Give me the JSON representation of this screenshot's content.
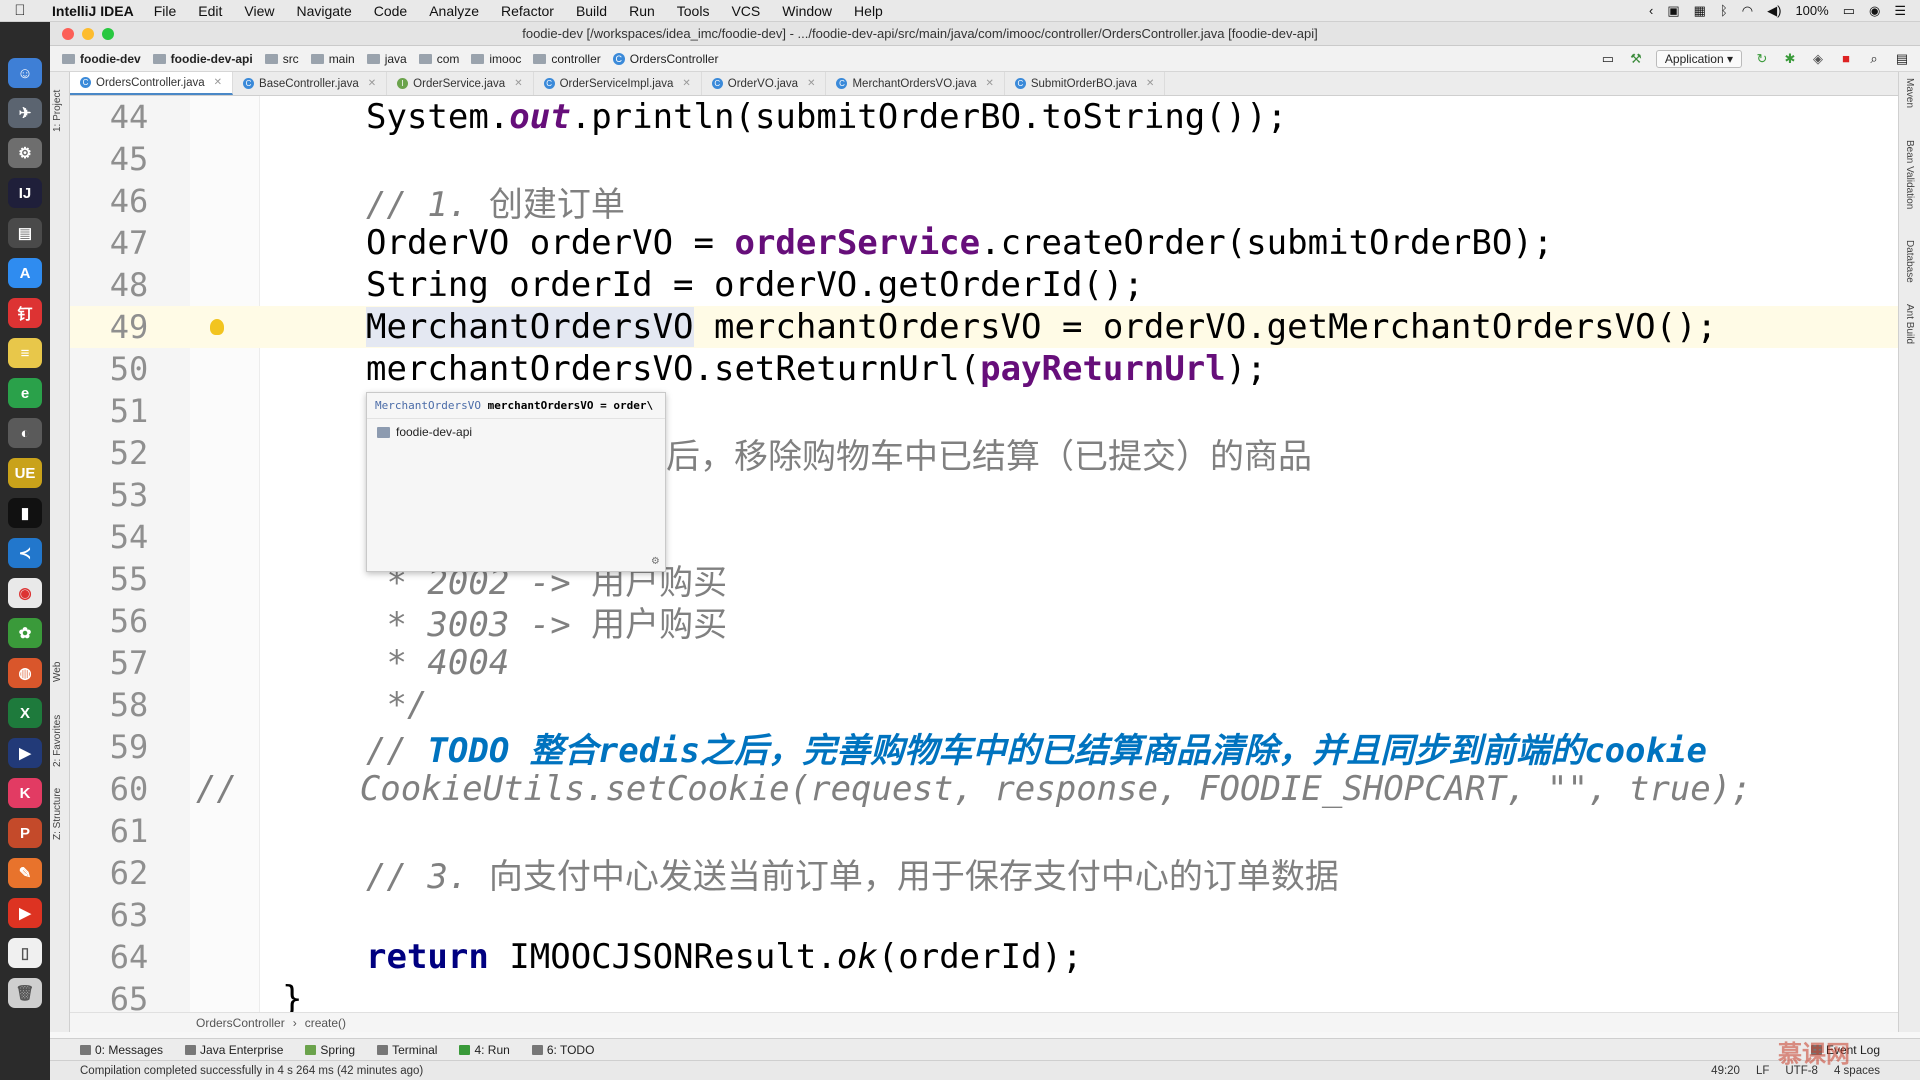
{
  "menubar": {
    "app_name": "IntelliJ IDEA",
    "items": [
      "File",
      "Edit",
      "View",
      "Navigate",
      "Code",
      "Analyze",
      "Refactor",
      "Build",
      "Run",
      "Tools",
      "VCS",
      "Window",
      "Help"
    ],
    "battery": "100%"
  },
  "window": {
    "title": "foodie-dev [/workspaces/idea_imc/foodie-dev] - .../foodie-dev-api/src/main/java/com/imooc/controller/OrdersController.java [foodie-dev-api]"
  },
  "breadcrumb": {
    "items": [
      "foodie-dev",
      "foodie-dev-api",
      "src",
      "main",
      "java",
      "com",
      "imooc",
      "controller",
      "OrdersController"
    ],
    "run_config": "Application"
  },
  "tabs": [
    {
      "label": "OrdersController.java",
      "icon": "C",
      "active": true
    },
    {
      "label": "BaseController.java",
      "icon": "C",
      "active": false
    },
    {
      "label": "OrderService.java",
      "icon": "I",
      "active": false
    },
    {
      "label": "OrderServiceImpl.java",
      "icon": "C",
      "active": false
    },
    {
      "label": "OrderVO.java",
      "icon": "C",
      "active": false
    },
    {
      "label": "MerchantOrdersVO.java",
      "icon": "C",
      "active": false
    },
    {
      "label": "SubmitOrderBO.java",
      "icon": "C",
      "active": false
    }
  ],
  "left_tools": [
    "1: Project",
    "Web",
    "2: Favorites",
    "Z: Structure"
  ],
  "right_tools": [
    "Maven",
    "Bean Validation",
    "Database",
    "Ant Build"
  ],
  "code": {
    "current_line": 49,
    "lines": {
      "l44": {
        "num": "44",
        "a": "System.",
        "b": "out",
        "c": ".println(submitOrderBO.toString());"
      },
      "l45": {
        "num": "45"
      },
      "l46": {
        "num": "46",
        "a": "// 1. ",
        "b": "创建订单"
      },
      "l47": {
        "num": "47",
        "a": "OrderVO orderVO = ",
        "b": "orderService",
        "c": ".createOrder(submitOrderBO);"
      },
      "l48": {
        "num": "48",
        "a": "String orderId = orderVO.getOrderId();"
      },
      "l49": {
        "num": "49",
        "a": "MerchantOrdersVO",
        "b": " merchantOrdersVO = orderVO.getMerchantOrdersVO();"
      },
      "l50": {
        "num": "50",
        "a": "merchantOrdersVO.setReturnUrl(",
        "b": "payReturnUrl",
        "c": ");"
      },
      "l51": {
        "num": "51"
      },
      "l52": {
        "num": "52",
        "a": "后，移除购物车中已结算（已提交）的商品"
      },
      "l53": {
        "num": "53"
      },
      "l54": {
        "num": "54"
      },
      "l55": {
        "num": "55",
        "a": " * 2002 -> ",
        "b": "用户购买"
      },
      "l56": {
        "num": "56",
        "a": " * 3003 -> ",
        "b": "用户购买"
      },
      "l57": {
        "num": "57",
        "a": " * 4004"
      },
      "l58": {
        "num": "58",
        "a": " */"
      },
      "l59": {
        "num": "59",
        "a": "// ",
        "b": "TODO 整合redis之后，完善购物车中的已结算商品清除，并且同步到前端的cookie"
      },
      "l60": {
        "num": "60",
        "a": "//",
        "b": "      CookieUtils.setCookie(request, response, FOODIE_SHOPCART, \"\", true);"
      },
      "l61": {
        "num": "61"
      },
      "l62": {
        "num": "62",
        "a": "// 3. ",
        "b": "向支付中心发送当前订单，用于保存支付中心的订单数据"
      },
      "l63": {
        "num": "63"
      },
      "l64": {
        "num": "64",
        "a": "return",
        "b": " IMOOCJSONResult.",
        "c": "ok",
        "d": "(orderId);"
      },
      "l65": {
        "num": "65",
        "a": "}"
      }
    }
  },
  "popup": {
    "header_type": "MerchantOrdersVO",
    "header_code": "merchantOrdersVO = order\\",
    "module": "foodie-dev-api"
  },
  "editor_breadcrumb": [
    "OrdersController",
    "create()"
  ],
  "bottom_tools": [
    {
      "label": "0: Messages"
    },
    {
      "label": "Java Enterprise"
    },
    {
      "label": "Spring"
    },
    {
      "label": "Terminal"
    },
    {
      "label": "4: Run"
    },
    {
      "label": "6: TODO"
    }
  ],
  "event_log": "Event Log",
  "status": {
    "message": "Compilation completed successfully in 4 s 264 ms (42 minutes ago)",
    "position": "49:20",
    "line_sep": "LF",
    "encoding": "UTF-8",
    "indent": "4 spaces"
  },
  "watermark": "慕课网"
}
